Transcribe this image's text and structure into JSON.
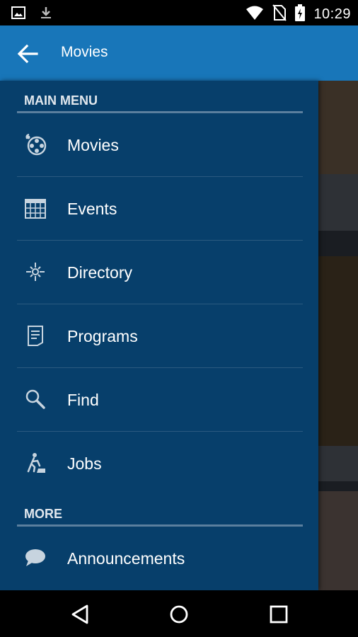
{
  "status_bar": {
    "time": "10:29",
    "icons": [
      "image-icon",
      "download-icon",
      "wifi-icon",
      "no-sim-icon",
      "battery-charging-icon"
    ]
  },
  "app_bar": {
    "title": "Movies",
    "back_icon": "arrow-back-icon",
    "color": "#1876b9"
  },
  "drawer": {
    "background": "#073f6b",
    "main_menu": {
      "header": "MAIN MENU",
      "items": [
        {
          "label": "Movies",
          "icon": "film-reel-icon"
        },
        {
          "label": "Events",
          "icon": "calendar-icon"
        },
        {
          "label": "Directory",
          "icon": "compass-icon"
        },
        {
          "label": "Programs",
          "icon": "document-icon"
        },
        {
          "label": "Find",
          "icon": "search-icon"
        },
        {
          "label": "Jobs",
          "icon": "worker-icon"
        }
      ]
    },
    "more": {
      "header": "MORE",
      "items": [
        {
          "label": "Announcements",
          "icon": "chat-bubble-icon"
        }
      ]
    }
  },
  "nav_bar": {
    "buttons": [
      "back-triangle-icon",
      "home-circle-icon",
      "recents-square-icon"
    ]
  }
}
